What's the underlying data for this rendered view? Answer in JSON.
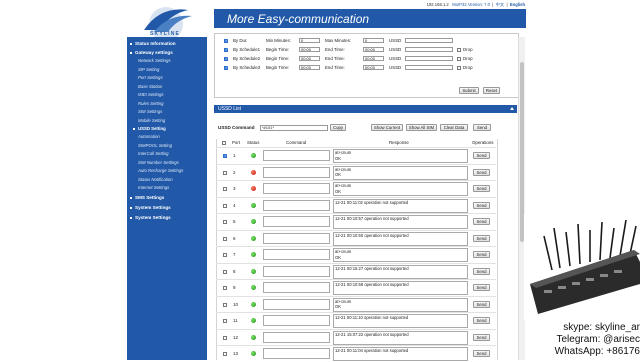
{
  "header": {
    "ip": "192.168.1.2",
    "version": "MoIP32 Version: 7.0",
    "lang_cn": "中文",
    "lang_en": "English",
    "banner_title": "More Easy-communication",
    "logo_text": "SKYLINE"
  },
  "sidebar": {
    "items": [
      {
        "label": "Status Information",
        "type": "head"
      },
      {
        "label": "Gateway settings",
        "type": "head"
      },
      {
        "label": "Network Settings",
        "type": "sub"
      },
      {
        "label": "SIP Setting",
        "type": "sub"
      },
      {
        "label": "Port Settings",
        "type": "sub"
      },
      {
        "label": "Base Station",
        "type": "sub"
      },
      {
        "label": "IMEI Settings",
        "type": "sub"
      },
      {
        "label": "Rules Setting",
        "type": "sub"
      },
      {
        "label": "SIM Settings",
        "type": "sub"
      },
      {
        "label": "Mobile Setting",
        "type": "sub"
      },
      {
        "label": "USSD Setting",
        "type": "active"
      },
      {
        "label": "Automation",
        "type": "sub"
      },
      {
        "label": "SIMPOOL Setting",
        "type": "sub"
      },
      {
        "label": "InterCall Setting",
        "type": "sub"
      },
      {
        "label": "SIM Number Settings",
        "type": "sub"
      },
      {
        "label": "Auto Recharge Settings",
        "type": "sub"
      },
      {
        "label": "Status Notification",
        "type": "sub"
      },
      {
        "label": "Internet Settings",
        "type": "sub"
      },
      {
        "label": "SMS Settings",
        "type": "head"
      },
      {
        "label": "System Settings",
        "type": "head"
      },
      {
        "label": "System Settings",
        "type": "head"
      }
    ]
  },
  "schedule": {
    "rows": [
      {
        "label": "By Dur.",
        "time_a_label": "Min Minutes:",
        "time_a": "0",
        "time_b_label": "Max Minutes:",
        "time_b": "0",
        "ussd_label": "USSD",
        "drop": ""
      },
      {
        "label": "By Schedule1",
        "time_a_label": "Begin Time:",
        "time_a": "00:00",
        "time_b_label": "End Time:",
        "time_b": "00:00",
        "ussd_label": "USSD",
        "drop": "Drop"
      },
      {
        "label": "By Schedule2",
        "time_a_label": "Begin Time:",
        "time_a": "00:00",
        "time_b_label": "End Time:",
        "time_b": "00:00",
        "ussd_label": "USSD",
        "drop": "Drop"
      },
      {
        "label": "By Schedule3",
        "time_a_label": "Begin Time:",
        "time_a": "00:00",
        "time_b_label": "End Time:",
        "time_b": "00:00",
        "ussd_label": "USSD",
        "drop": "Drop"
      }
    ],
    "submit": "Submit",
    "reset": "Reset"
  },
  "ussd_list": {
    "title": "USSD List",
    "command_label": "USSD Command",
    "command_value": "*#101*",
    "copy": "Copy",
    "show_current": "Show Current",
    "show_all_sim": "Show All SIM",
    "clear_data": "Clear Data",
    "send": "Send",
    "columns": {
      "port": "Port",
      "status": "Status",
      "command": "Command",
      "response": "Response",
      "operations": "Operations"
    },
    "rows": [
      {
        "port": "1",
        "status": "green",
        "checked": true,
        "resp1": "at+cnum",
        "resp2": "OK",
        "op": "Send"
      },
      {
        "port": "2",
        "status": "red",
        "checked": false,
        "resp1": "at+cnum",
        "resp2": "OK",
        "op": "Send"
      },
      {
        "port": "3",
        "status": "red",
        "checked": false,
        "resp1": "at+cnum",
        "resp2": "OK",
        "op": "Send"
      },
      {
        "port": "4",
        "status": "green",
        "checked": false,
        "resp1": "12-21 00:11:02 operation not supported",
        "resp2": "",
        "op": "Send"
      },
      {
        "port": "5",
        "status": "green",
        "checked": false,
        "resp1": "12-21 00:10:57 operation not supported",
        "resp2": "",
        "op": "Send"
      },
      {
        "port": "6",
        "status": "green",
        "checked": false,
        "resp1": "12-21 00:10:50 operation not supported",
        "resp2": "",
        "op": "Send"
      },
      {
        "port": "7",
        "status": "green",
        "checked": false,
        "resp1": "at+cnum",
        "resp2": "OK",
        "op": "Send"
      },
      {
        "port": "8",
        "status": "green",
        "checked": false,
        "resp1": "12-21 00:15:27 operation not supported",
        "resp2": "",
        "op": "Send"
      },
      {
        "port": "9",
        "status": "green",
        "checked": false,
        "resp1": "12-21 00:10:58 operation not supported",
        "resp2": "",
        "op": "Send"
      },
      {
        "port": "10",
        "status": "green",
        "checked": false,
        "resp1": "at+cnum",
        "resp2": "OK",
        "op": "Send"
      },
      {
        "port": "11",
        "status": "green",
        "checked": false,
        "resp1": "12-21 00:11:10 operation not supported",
        "resp2": "",
        "op": "Send"
      },
      {
        "port": "12",
        "status": "green",
        "checked": false,
        "resp1": "12-21 15:07:22 operation not supported",
        "resp2": "",
        "op": "Send"
      },
      {
        "port": "13",
        "status": "green",
        "checked": false,
        "resp1": "12-21 00:11:04 operation not supported",
        "resp2": "",
        "op": "Send"
      }
    ]
  },
  "overlay": {
    "skype": "skype: skyline_ar",
    "telegram": "Telegram: @arisec",
    "whatsapp": "WhatsApp: +86176"
  },
  "colors": {
    "brand": "#2159a8",
    "status_ok": "#2ea51f",
    "status_err": "#d4180c"
  }
}
